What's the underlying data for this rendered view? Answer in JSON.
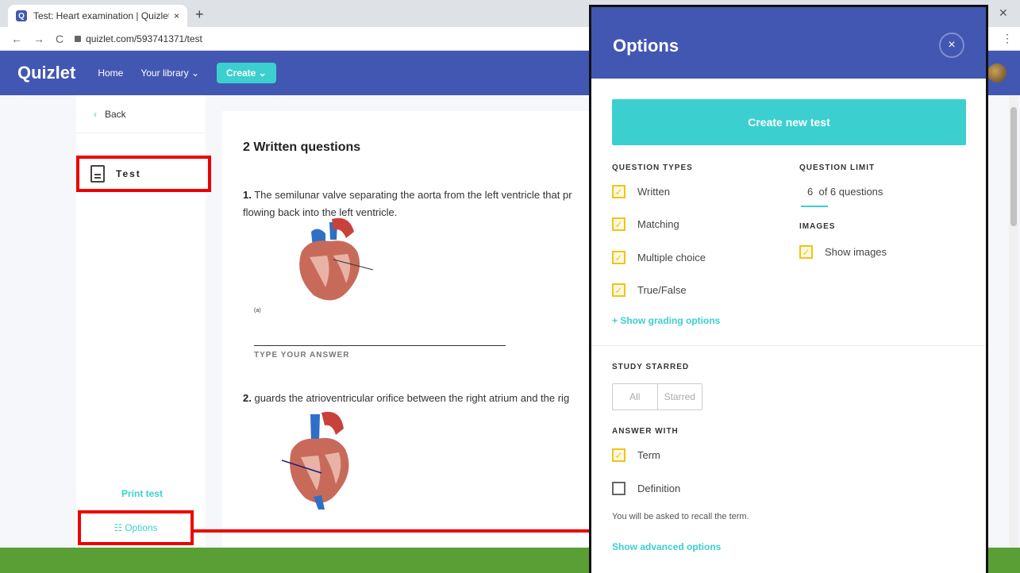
{
  "browser": {
    "tab_title": "Test: Heart examination | Quizlet",
    "tab_close": "×",
    "new_tab": "+",
    "url": "quizlet.com/593741371/test",
    "favicon": "Q"
  },
  "header": {
    "logo": "Quizlet",
    "nav": [
      "Home",
      "Your library ⌄"
    ],
    "create_label": "Create ⌄"
  },
  "sidebar": {
    "back_label": "Back",
    "test_label": "Test",
    "print_label": "Print test",
    "options_label": "Options"
  },
  "main": {
    "section_title": "2 Written questions",
    "questions": [
      {
        "number": "1.",
        "text_line1": "The semilunar valve separating the aorta from the left ventricle that pr",
        "text_line2": "flowing back into the left ventricle.",
        "answer_hint": "TYPE YOUR ANSWER",
        "caption": "(a)"
      },
      {
        "number": "2.",
        "text_line1": "guards the atrioventricular orifice between the right atrium and the rig"
      }
    ]
  },
  "options_panel": {
    "title": "Options",
    "close": "×",
    "create_button": "Create new test",
    "question_types_label": "QUESTION TYPES",
    "question_types": [
      {
        "label": "Written",
        "checked": true
      },
      {
        "label": "Matching",
        "checked": true
      },
      {
        "label": "Multiple choice",
        "checked": true
      },
      {
        "label": "True/False",
        "checked": true
      }
    ],
    "question_limit_label": "QUESTION LIMIT",
    "question_limit_value": "6",
    "question_limit_suffix": "of 6 questions",
    "images_label": "IMAGES",
    "show_images": {
      "label": "Show images",
      "checked": true
    },
    "grading_link": "+ Show grading options",
    "study_starred_label": "STUDY STARRED",
    "starred_options": [
      "All",
      "Starred"
    ],
    "answer_with_label": "ANSWER WITH",
    "answer_with": [
      {
        "label": "Term",
        "checked": true
      },
      {
        "label": "Definition",
        "checked": false
      }
    ],
    "recall_text": "You will be asked to recall the term.",
    "advanced_link": "Show advanced options"
  },
  "colors": {
    "brand": "#4257b2",
    "accent": "#3ccfcf",
    "checkbox": "#f0c419",
    "annotation": "#e00000",
    "footer": "#5a9e36"
  }
}
